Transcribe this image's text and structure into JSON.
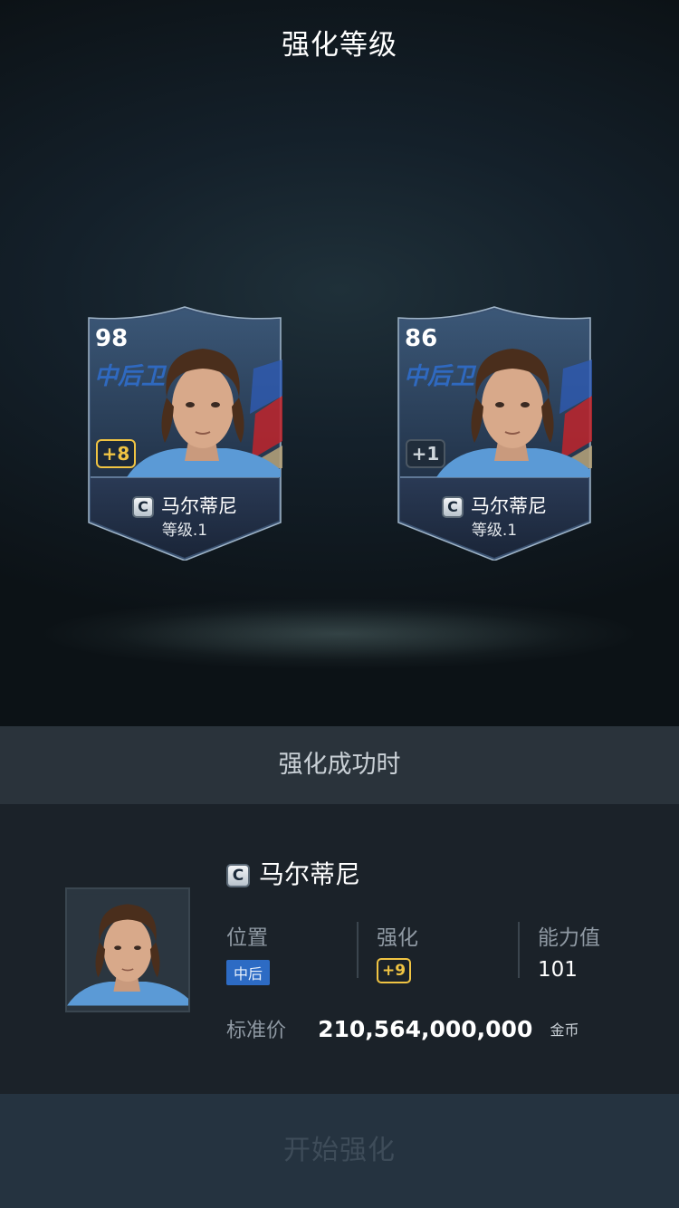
{
  "header": {
    "title": "强化等级"
  },
  "cards": [
    {
      "rating": "98",
      "position": "中后卫",
      "grade": "+8",
      "grade_style": "gold",
      "player_name": "马尔蒂尼",
      "level": "等级.1",
      "class_icon": "C"
    },
    {
      "rating": "86",
      "position": "中后卫",
      "grade": "+1",
      "grade_style": "gray",
      "player_name": "马尔蒂尼",
      "level": "等级.1",
      "class_icon": "C"
    }
  ],
  "section": {
    "title": "强化成功时"
  },
  "detail": {
    "class_icon": "C",
    "player_name": "马尔蒂尼",
    "position_label": "位置",
    "position_value": "中后",
    "enhance_label": "强化",
    "enhance_value": "+9",
    "ability_label": "能力值",
    "ability_value": "101",
    "price_label": "标准价",
    "price_value": "210,564,000,000",
    "price_unit": "金币"
  },
  "actions": {
    "start_label": "开始强化"
  },
  "colors": {
    "accent_gold": "#f0c443",
    "position_blue": "#2d6bc4",
    "button_bg": "#253340",
    "button_text_disabled": "#3e4c59"
  }
}
